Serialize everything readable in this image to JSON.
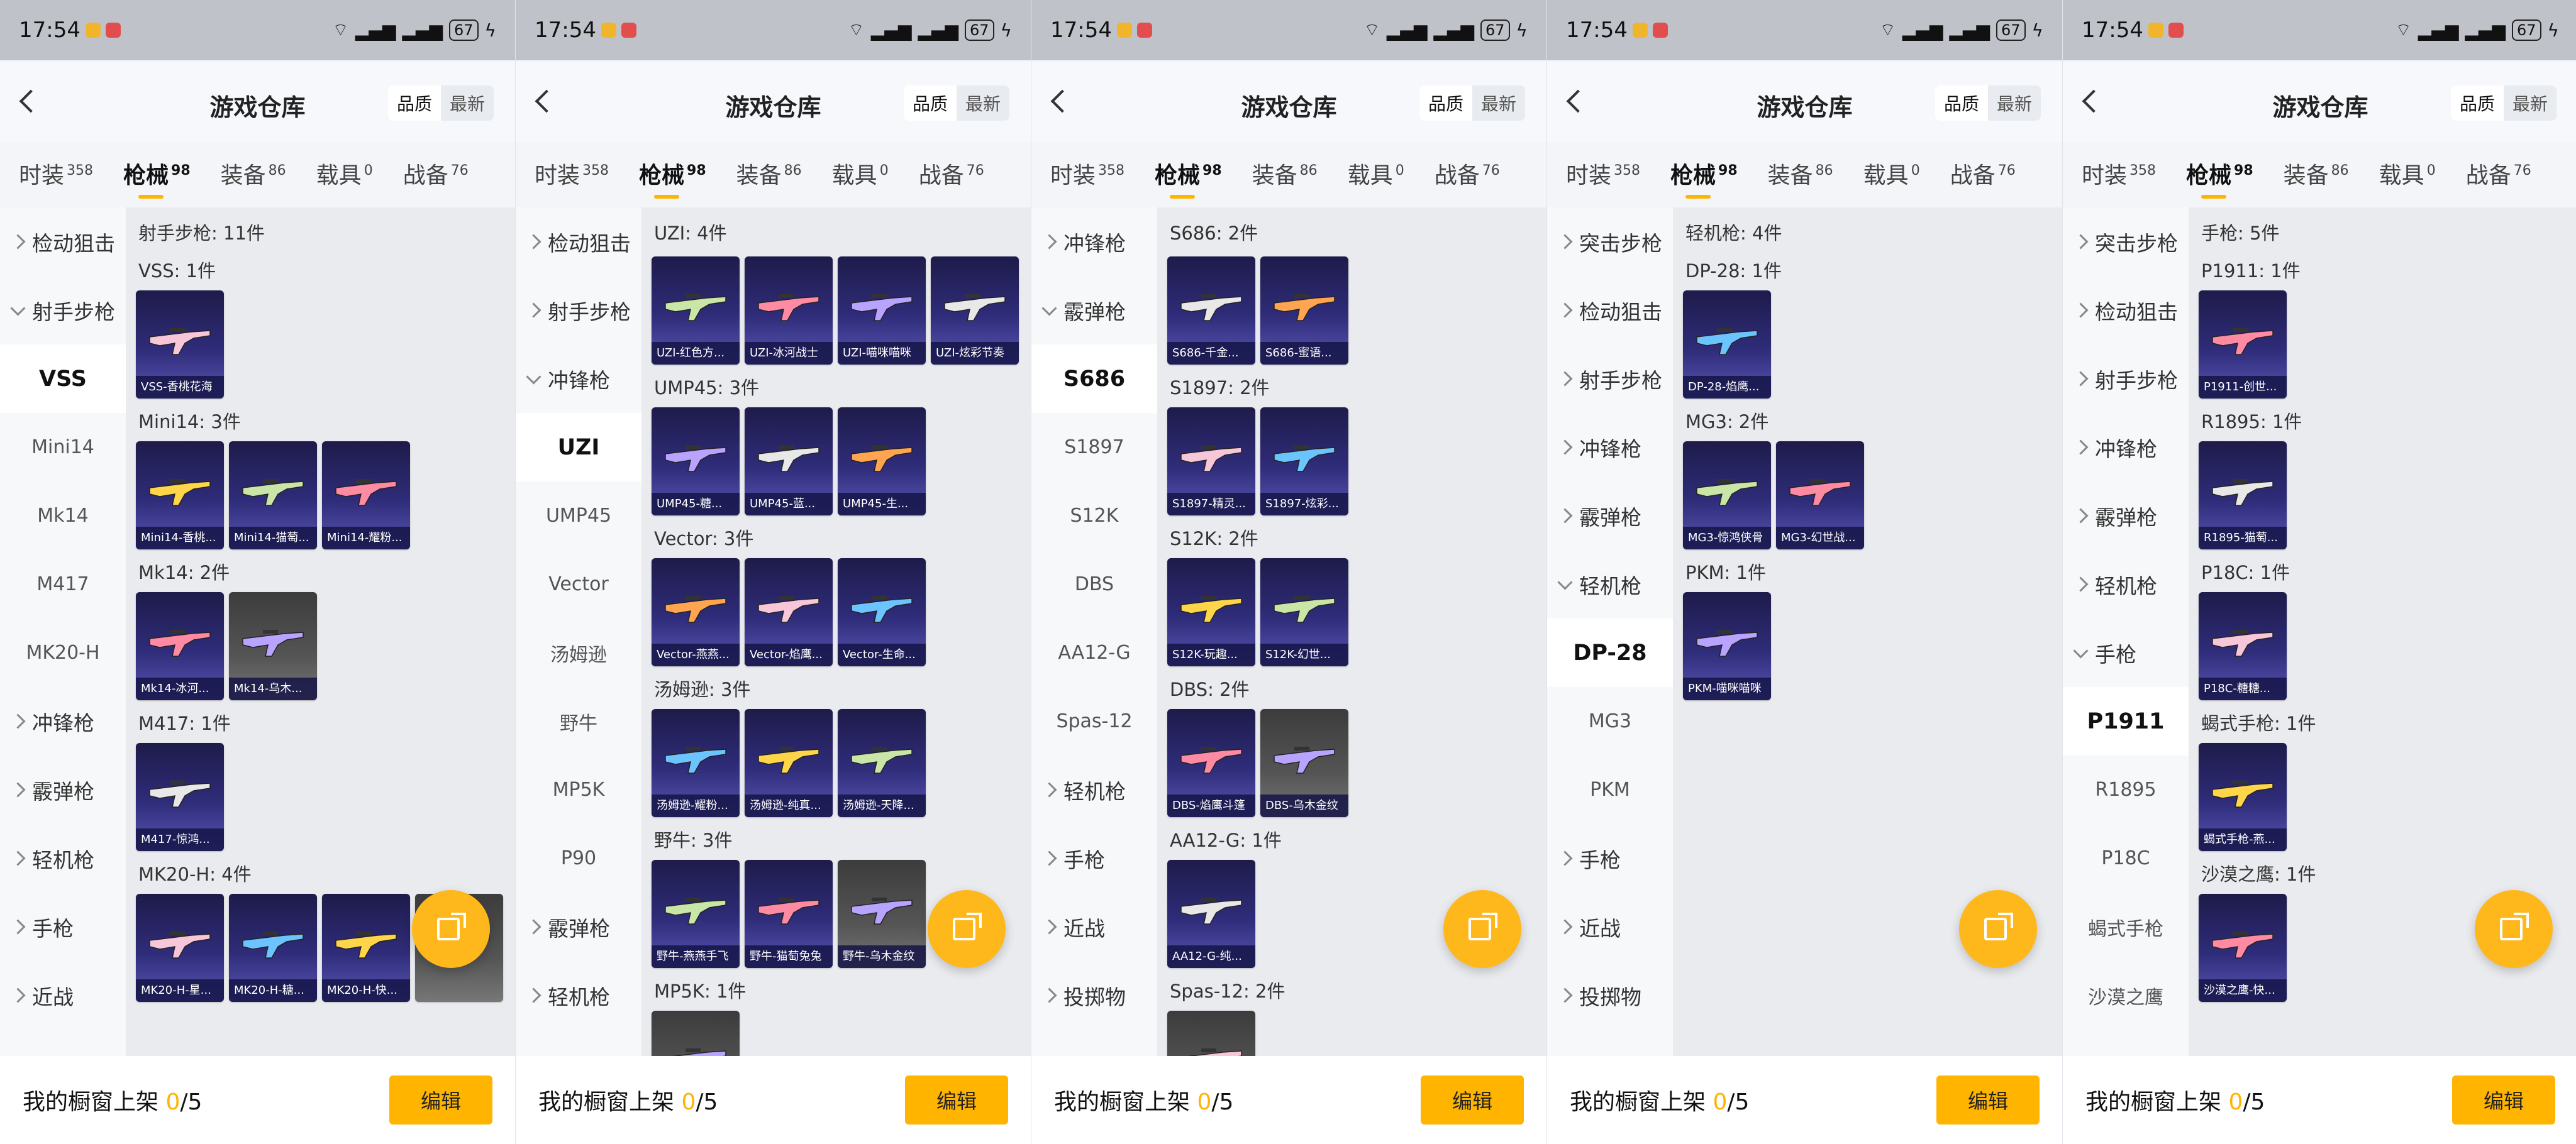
{
  "status": {
    "time": "17:54",
    "battery": "67"
  },
  "header": {
    "title": "游戏仓库",
    "sort_quality": "品质",
    "sort_latest": "最新"
  },
  "tabs": [
    {
      "label": "时装",
      "count": "358"
    },
    {
      "label": "枪械",
      "count": "98"
    },
    {
      "label": "装备",
      "count": "86"
    },
    {
      "label": "载具",
      "count": "0"
    },
    {
      "label": "战备",
      "count": "76"
    }
  ],
  "bottom": {
    "label": "我的橱窗上架",
    "current": "0",
    "sep": "/",
    "total": "5",
    "edit": "编辑"
  },
  "panels": [
    {
      "sidebar": [
        {
          "t": "检动狙击",
          "k": "cat"
        },
        {
          "t": "射手步枪",
          "k": "open"
        },
        {
          "t": "VSS",
          "k": "sel"
        },
        {
          "t": "Mini14",
          "k": "sub"
        },
        {
          "t": "Mk14",
          "k": "sub"
        },
        {
          "t": "M417",
          "k": "sub"
        },
        {
          "t": "MK20-H",
          "k": "sub"
        },
        {
          "t": "冲锋枪",
          "k": "cat"
        },
        {
          "t": "霰弹枪",
          "k": "cat"
        },
        {
          "t": "轻机枪",
          "k": "cat"
        },
        {
          "t": "手枪",
          "k": "cat"
        },
        {
          "t": "近战",
          "k": "cat"
        }
      ],
      "section": "射手步枪: 11件",
      "groups": [
        {
          "title": "VSS: 1件",
          "items": [
            "VSS-香桃花海"
          ]
        },
        {
          "title": "Mini14: 3件",
          "items": [
            "Mini14-香桃...",
            "Mini14-猫萄...",
            "Mini14-耀粉..."
          ]
        },
        {
          "title": "Mk14: 2件",
          "items": [
            "Mk14-冰河...",
            "Mk14-乌木..."
          ]
        },
        {
          "title": "M417: 1件",
          "items": [
            "M417-惊鸿..."
          ]
        },
        {
          "title": "MK20-H: 4件",
          "items": [
            "MK20-H-星...",
            "MK20-H-糖...",
            "MK20-H-快...",
            ""
          ]
        }
      ]
    },
    {
      "sidebar": [
        {
          "t": "检动狙击",
          "k": "cat"
        },
        {
          "t": "射手步枪",
          "k": "cat"
        },
        {
          "t": "冲锋枪",
          "k": "open"
        },
        {
          "t": "UZI",
          "k": "sel"
        },
        {
          "t": "UMP45",
          "k": "sub"
        },
        {
          "t": "Vector",
          "k": "sub"
        },
        {
          "t": "汤姆逊",
          "k": "sub"
        },
        {
          "t": "野牛",
          "k": "sub"
        },
        {
          "t": "MP5K",
          "k": "sub"
        },
        {
          "t": "P90",
          "k": "sub"
        },
        {
          "t": "霰弹枪",
          "k": "cat"
        },
        {
          "t": "轻机枪",
          "k": "cat"
        }
      ],
      "section": "UZI: 4件",
      "groups": [
        {
          "title": "",
          "items": [
            "UZI-红色方...",
            "UZI-冰河战士",
            "UZI-喵咪喵咪",
            "UZI-炫彩节奏"
          ]
        },
        {
          "title": "UMP45: 3件",
          "items": [
            "UMP45-糖...",
            "UMP45-蓝...",
            "UMP45-生..."
          ]
        },
        {
          "title": "Vector: 3件",
          "items": [
            "Vector-燕燕...",
            "Vector-焰鹰...",
            "Vector-生命..."
          ]
        },
        {
          "title": "汤姆逊: 3件",
          "items": [
            "汤姆逊-耀粉...",
            "汤姆逊-纯真...",
            "汤姆逊-天降..."
          ]
        },
        {
          "title": "野牛: 3件",
          "items": [
            "野牛-燕燕手飞",
            "野牛-猫萄兔兔",
            "野牛-乌木金纹"
          ]
        },
        {
          "title": "MP5K: 1件",
          "items": []
        }
      ]
    },
    {
      "sidebar": [
        {
          "t": "冲锋枪",
          "k": "cat"
        },
        {
          "t": "霰弹枪",
          "k": "open"
        },
        {
          "t": "S686",
          "k": "sel"
        },
        {
          "t": "S1897",
          "k": "sub"
        },
        {
          "t": "S12K",
          "k": "sub"
        },
        {
          "t": "DBS",
          "k": "sub"
        },
        {
          "t": "AA12-G",
          "k": "sub"
        },
        {
          "t": "Spas-12",
          "k": "sub"
        },
        {
          "t": "轻机枪",
          "k": "cat"
        },
        {
          "t": "手枪",
          "k": "cat"
        },
        {
          "t": "近战",
          "k": "cat"
        },
        {
          "t": "投掷物",
          "k": "cat"
        }
      ],
      "section": "S686: 2件",
      "groups": [
        {
          "title": "",
          "items": [
            "S686-千金...",
            "S686-蜜语..."
          ]
        },
        {
          "title": "S1897: 2件",
          "items": [
            "S1897-精灵...",
            "S1897-炫彩..."
          ]
        },
        {
          "title": "S12K: 2件",
          "items": [
            "S12K-玩趣...",
            "S12K-幻世..."
          ]
        },
        {
          "title": "DBS: 2件",
          "items": [
            "DBS-焰鹰斗篷",
            "DBS-乌木金纹"
          ]
        },
        {
          "title": "AA12-G: 1件",
          "items": [
            "AA12-G-纯..."
          ]
        },
        {
          "title": "Spas-12: 2件",
          "items": []
        }
      ]
    },
    {
      "sidebar": [
        {
          "t": "突击步枪",
          "k": "cat"
        },
        {
          "t": "检动狙击",
          "k": "cat"
        },
        {
          "t": "射手步枪",
          "k": "cat"
        },
        {
          "t": "冲锋枪",
          "k": "cat"
        },
        {
          "t": "霰弹枪",
          "k": "cat"
        },
        {
          "t": "轻机枪",
          "k": "open"
        },
        {
          "t": "DP-28",
          "k": "sel"
        },
        {
          "t": "MG3",
          "k": "sub"
        },
        {
          "t": "PKM",
          "k": "sub"
        },
        {
          "t": "手枪",
          "k": "cat"
        },
        {
          "t": "近战",
          "k": "cat"
        },
        {
          "t": "投掷物",
          "k": "cat"
        }
      ],
      "section": "轻机枪: 4件",
      "groups": [
        {
          "title": "DP-28: 1件",
          "items": [
            "DP-28-焰鹰..."
          ]
        },
        {
          "title": "MG3: 2件",
          "items": [
            "MG3-惊鸿侠骨",
            "MG3-幻世战..."
          ]
        },
        {
          "title": "PKM: 1件",
          "items": [
            "PKM-喵咪喵咪"
          ]
        }
      ]
    },
    {
      "sidebar": [
        {
          "t": "突击步枪",
          "k": "cat"
        },
        {
          "t": "检动狙击",
          "k": "cat"
        },
        {
          "t": "射手步枪",
          "k": "cat"
        },
        {
          "t": "冲锋枪",
          "k": "cat"
        },
        {
          "t": "霰弹枪",
          "k": "cat"
        },
        {
          "t": "轻机枪",
          "k": "cat"
        },
        {
          "t": "手枪",
          "k": "open"
        },
        {
          "t": "P1911",
          "k": "sel"
        },
        {
          "t": "R1895",
          "k": "sub"
        },
        {
          "t": "P18C",
          "k": "sub"
        },
        {
          "t": "蝎式手枪",
          "k": "sub"
        },
        {
          "t": "沙漠之鹰",
          "k": "sub"
        }
      ],
      "section": "手枪: 5件",
      "groups": [
        {
          "title": "P1911: 1件",
          "items": [
            "P1911-创世..."
          ]
        },
        {
          "title": "R1895: 1件",
          "items": [
            "R1895-猫萄..."
          ]
        },
        {
          "title": "P18C: 1件",
          "items": [
            "P18C-糖糖..."
          ]
        },
        {
          "title": "蝎式手枪: 1件",
          "items": [
            "蝎式手枪-燕..."
          ]
        },
        {
          "title": "沙漠之鹰: 1件",
          "items": [
            "沙漠之鹰-快..."
          ]
        }
      ]
    }
  ]
}
